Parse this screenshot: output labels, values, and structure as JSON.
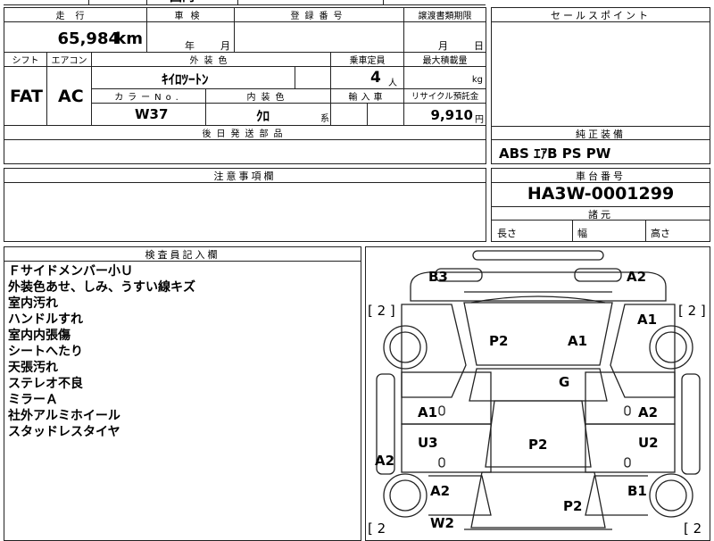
{
  "top_strip": {
    "partial_text": "国内"
  },
  "mileage": {
    "label": "走行",
    "value": "65,984",
    "unit": "km"
  },
  "inspection": {
    "label": "車検",
    "year_unit": "年",
    "month_unit": "月"
  },
  "registration": {
    "label": "登録番号",
    "value": ""
  },
  "transfer_deadline": {
    "label": "譲渡書類期限",
    "month_unit": "月",
    "day_unit": "日"
  },
  "sales_point": {
    "label": "セールスポイント",
    "value": ""
  },
  "shift": {
    "label": "シフト",
    "value": "FAT"
  },
  "aircon": {
    "label": "エアコン",
    "value": "AC"
  },
  "exterior_color": {
    "label": "外装色",
    "value": "ｷｲﾛﾂｰﾄﾝ"
  },
  "capacity": {
    "label": "乗車定員",
    "value": "4",
    "unit": "人"
  },
  "max_load": {
    "label": "最大積載量",
    "unit": "kg"
  },
  "color_no": {
    "label": "カラーNo.",
    "value": "W37"
  },
  "interior_color": {
    "label": "内装色",
    "value": "ｸﾛ",
    "suffix": "系"
  },
  "import": {
    "label": "輸入車"
  },
  "recycle": {
    "label": "リサイクル預託金",
    "value": "9,910",
    "unit": "円"
  },
  "later_parts": {
    "label": "後日発送部品",
    "value": ""
  },
  "standard_equipment": {
    "label": "純正装備",
    "value": "ABS ｴｱB PS PW"
  },
  "notes": {
    "label": "注意事項欄",
    "value": ""
  },
  "chassis": {
    "label": "車台番号",
    "value": "HA3W-0001299"
  },
  "dimensions": {
    "label": "諸元",
    "length": "長さ",
    "width": "幅",
    "height": "高さ"
  },
  "inspector": {
    "label": "検査員記入欄",
    "remarks": [
      "Ｆサイドメンバー小Ｕ",
      "外装色あせ、しみ、うすい線キズ",
      "室内汚れ",
      "ハンドルすれ",
      "室内内張傷",
      "シートへたり",
      "天張汚れ",
      "ステレオ不良",
      "ミラーＡ",
      "社外アルミホイール",
      "スタッドレスタイヤ"
    ]
  },
  "damage_marks": {
    "rear_left": "B3",
    "rear_right": "A2",
    "rear_glass_left": "P2",
    "rear_glass_right": "A1",
    "quarter_right": "A1",
    "roof": "G",
    "rear_door_left": "A1",
    "rear_door_right": "A2",
    "front_door_left": "U3",
    "front_door_right": "U2",
    "side_sill_left": "A2",
    "center": "P2",
    "fender_left": "A2",
    "fender_right": "B1",
    "windshield": "P2",
    "front_left": "W2"
  },
  "tire_marks": {
    "top_left": "[ 2 ]",
    "top_right": "[ 2 ]",
    "bottom_left": "[ 2",
    "bottom_right": "[ 2"
  }
}
